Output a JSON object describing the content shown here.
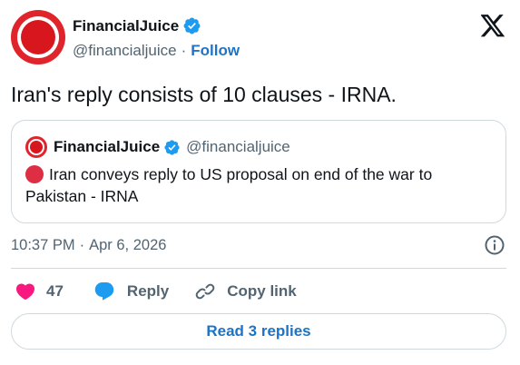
{
  "post": {
    "author": {
      "display_name": "FinancialJuice",
      "handle": "@financialjuice",
      "separator": "·",
      "follow_label": "Follow"
    },
    "text": "Iran's reply consists of 10 clauses - IRNA.",
    "quoted": {
      "display_name": "FinancialJuice",
      "handle": "@financialjuice",
      "text": "Iran conveys reply to US proposal on end of the war to Pakistan - IRNA"
    },
    "time": "10:37 PM",
    "date_separator": "·",
    "date": "Apr 6, 2026",
    "actions": {
      "like_count": "47",
      "reply_label": "Reply",
      "copy_link_label": "Copy link"
    },
    "read_replies_label": "Read 3 replies"
  },
  "icons": {
    "verified": "verified-badge-icon",
    "x_logo": "x-logo-icon",
    "info": "info-icon",
    "like": "heart-icon",
    "reply": "speech-bubble-icon",
    "copy_link": "link-icon",
    "quoted_bullet": "red-circle-icon"
  },
  "colors": {
    "brand_red": "#e0242c",
    "link_blue": "#1d73c5",
    "verified_blue": "#1d9bf0",
    "like_pink": "#f91880",
    "reply_blue": "#1d9bf0",
    "muted_text": "#536471",
    "border": "#cfd9de"
  }
}
